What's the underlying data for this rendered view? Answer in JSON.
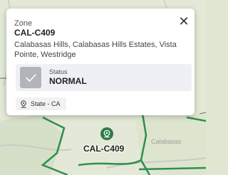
{
  "popup": {
    "kicker": "Zone",
    "title": "CAL-C409",
    "description": "Calabasas Hills, Calabasas Hills Estates, Vista Pointe, Westridge",
    "close_symbol": "✕",
    "status": {
      "label": "Status",
      "value": "NORMAL",
      "icon": "check-icon"
    },
    "chip": {
      "icon": "location-pin-icon",
      "label": "State - CA"
    }
  },
  "map": {
    "marker_label": "CAL-C409",
    "place_label": "Calabasas",
    "zone_border_color": "#2f8f4e",
    "marker_color": "#2f7a4b"
  }
}
